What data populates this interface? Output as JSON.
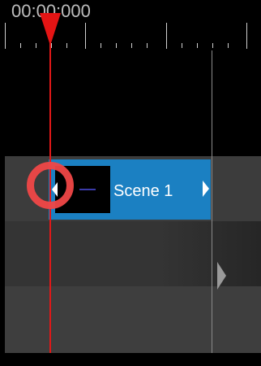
{
  "timeline": {
    "timecode": "00:00:000",
    "clip": {
      "label": "Scene 1"
    }
  },
  "icons": {
    "playhead": "playhead-marker-icon",
    "clip_handle_left": "clip-trim-left-icon",
    "clip_handle_right": "clip-trim-right-icon",
    "track_arrow": "track-expand-arrow-icon",
    "click_indicator": "click-ring-icon"
  },
  "colors": {
    "playhead": "#e41414",
    "clip": "#1b80c2",
    "click_ring": "#f04747",
    "background": "#000000"
  }
}
